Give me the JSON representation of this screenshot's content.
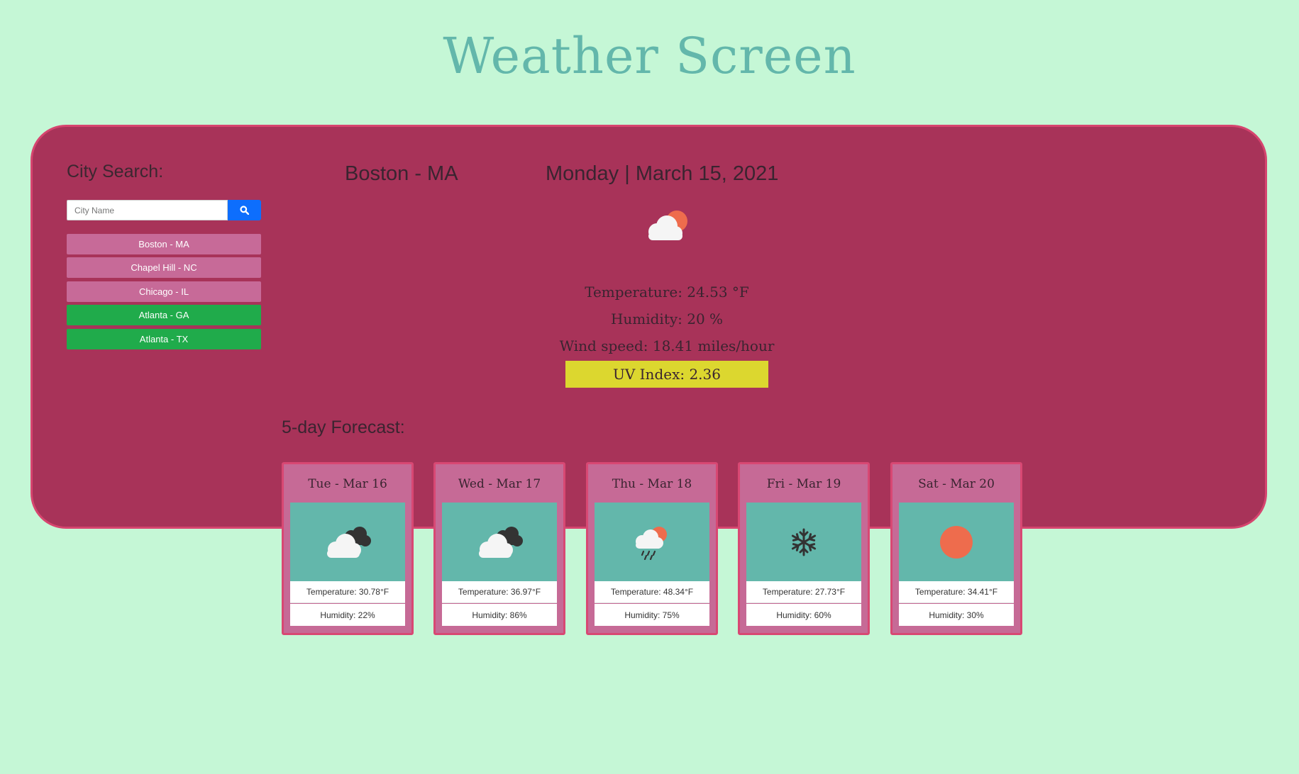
{
  "header": {
    "title": "Weather Screen"
  },
  "sidebar": {
    "search_label": "City Search:",
    "search_placeholder": "City Name",
    "search_icon": "search-icon",
    "cities": [
      {
        "label": "Boston - MA",
        "style": "saved"
      },
      {
        "label": "Chapel Hill - NC",
        "style": "saved"
      },
      {
        "label": "Chicago - IL",
        "style": "saved"
      },
      {
        "label": "Atlanta - GA",
        "style": "new"
      },
      {
        "label": "Atlanta - TX",
        "style": "new"
      }
    ]
  },
  "current": {
    "city": "Boston - MA",
    "date": "Monday | March 15, 2021",
    "icon": "partly-cloudy-icon",
    "temperature": "Temperature: 24.53 °F",
    "humidity": "Humidity: 20 %",
    "wind": "Wind speed: 18.41 miles/hour",
    "uv": "UV Index: 2.36",
    "uv_color": "#dcd72f"
  },
  "forecast": {
    "label": "5-day Forecast:",
    "days": [
      {
        "date": "Tue - Mar 16",
        "icon": "overcast-clouds-icon",
        "temperature": "Temperature: 30.78°F",
        "humidity": "Humidity: 22%"
      },
      {
        "date": "Wed - Mar 17",
        "icon": "overcast-clouds-icon",
        "temperature": "Temperature: 36.97°F",
        "humidity": "Humidity: 86%"
      },
      {
        "date": "Thu - Mar 18",
        "icon": "rain-icon",
        "temperature": "Temperature: 48.34°F",
        "humidity": "Humidity: 75%"
      },
      {
        "date": "Fri - Mar 19",
        "icon": "snowflake-icon",
        "temperature": "Temperature: 27.73°F",
        "humidity": "Humidity: 60%"
      },
      {
        "date": "Sat - Mar 20",
        "icon": "sun-icon",
        "temperature": "Temperature: 34.41°F",
        "humidity": "Humidity: 30%"
      }
    ]
  },
  "colors": {
    "background": "#c5f7d6",
    "panel": "#a83359",
    "title": "#63b7ab",
    "saved_city": "#c76a98",
    "new_city": "#20ab4b",
    "search_button": "#0d6efd",
    "card": "#c66a96"
  }
}
